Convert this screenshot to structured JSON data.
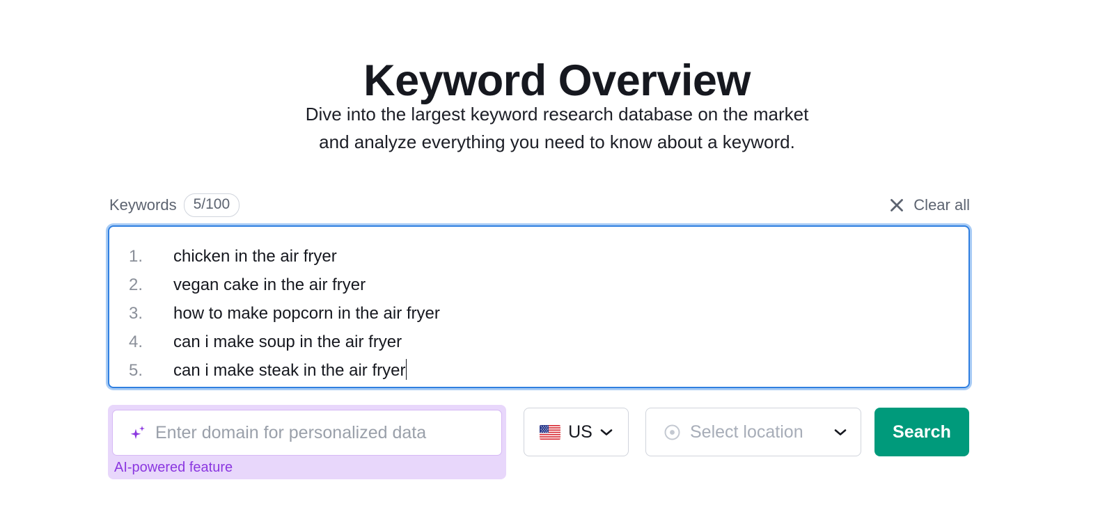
{
  "header": {
    "title": "Keyword Overview",
    "subtitle_line1": "Dive into the largest keyword research database on the market",
    "subtitle_line2": "and analyze everything you need to know about a keyword."
  },
  "keywords_bar": {
    "label": "Keywords",
    "counter": "5/100",
    "used": 5,
    "limit": 100,
    "clear_label": "Clear all",
    "clear_icon": "close-x-icon"
  },
  "keyword_input": {
    "items": [
      {
        "number": "1.",
        "text": "chicken in the air fryer"
      },
      {
        "number": "2.",
        "text": "vegan cake in the air fryer"
      },
      {
        "number": "3.",
        "text": "how to make popcorn in the air fryer"
      },
      {
        "number": "4.",
        "text": "can i make soup in the air fryer"
      },
      {
        "number": "5.",
        "text": "can i make steak in the air fryer"
      }
    ],
    "focused": true,
    "caret_after_item": 5
  },
  "domain_field": {
    "placeholder": "Enter domain for personalized data",
    "value": "",
    "icon": "ai-sparkle-icon",
    "note": "AI-powered feature"
  },
  "country_select": {
    "code": "US",
    "flag_icon": "us-flag-icon",
    "chevron_icon": "chevron-down-icon"
  },
  "location_select": {
    "placeholder": "Select location",
    "icon": "map-pin-icon",
    "chevron_icon": "chevron-down-icon"
  },
  "search_button": {
    "label": "Search"
  },
  "colors": {
    "page_background": "#ffffff",
    "title_text": "#16181f",
    "muted_text": "#5c6370",
    "textarea_border_focus": "#2f7fe0",
    "textarea_focus_ring": "#a9ccf5",
    "ai_accent": "#8b37e0",
    "ai_background": "#e8d7fb",
    "search_button": "#009a7b",
    "placeholder_text": "#9aa0aa"
  }
}
